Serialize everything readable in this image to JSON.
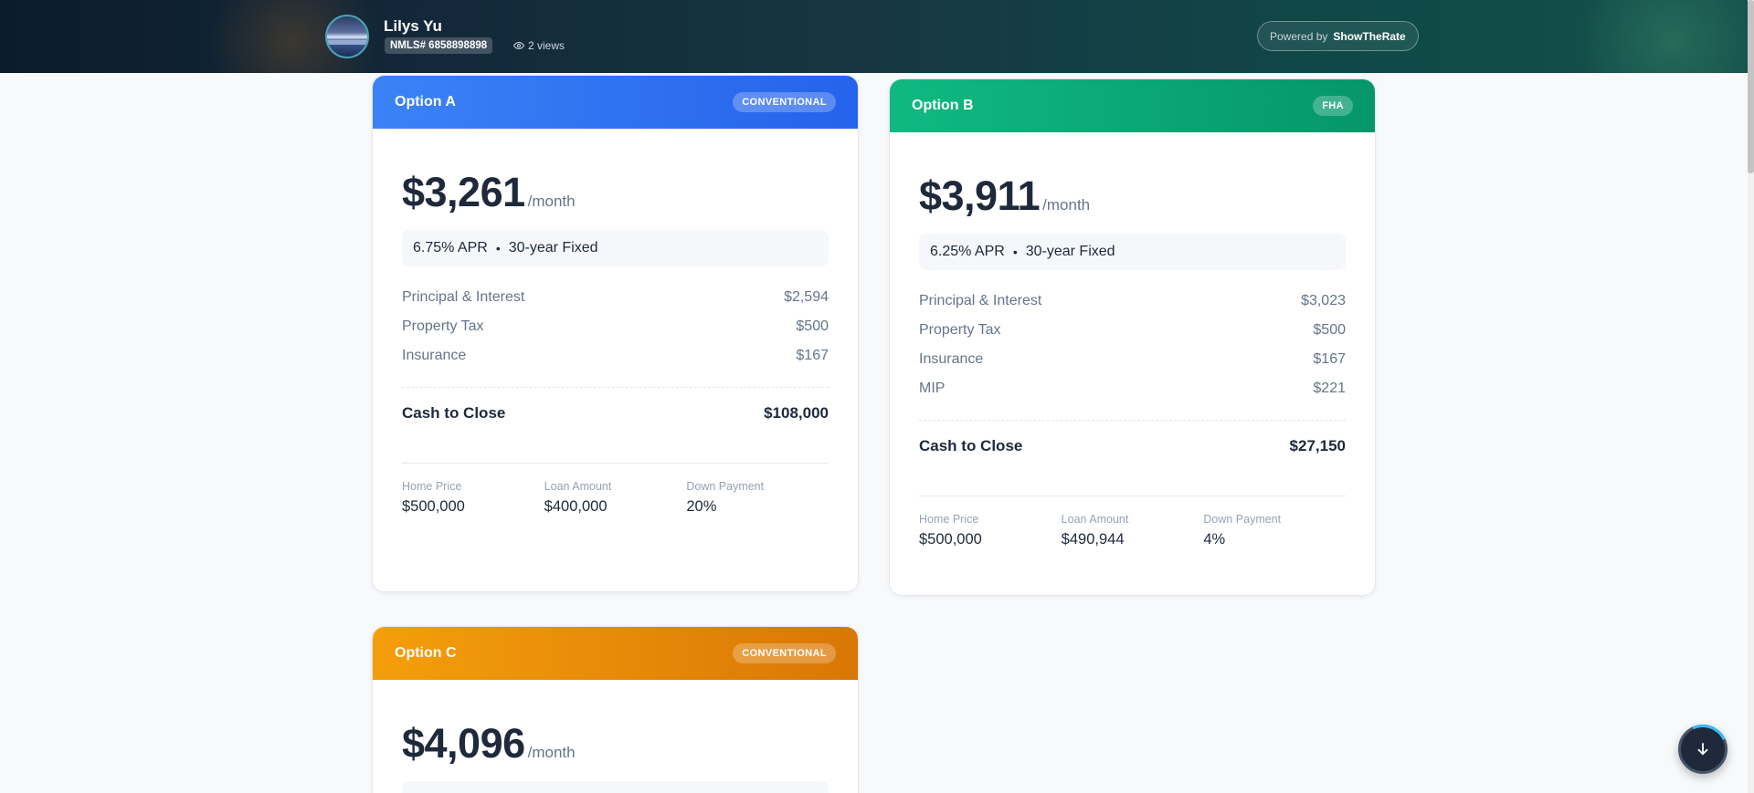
{
  "header": {
    "name": "Lilys Yu",
    "nmls": "NMLS# 6858898898",
    "views": "2 views",
    "powered_prefix": "Powered by",
    "powered_brand": "ShowTheRate"
  },
  "options": [
    {
      "title": "Option A",
      "badge": "CONVENTIONAL",
      "color": "#3b82f6",
      "payment": "$3,261",
      "per": "/month",
      "apr": "6.75% APR",
      "dot": "•",
      "term": "30-year Fixed",
      "items": [
        {
          "label": "Principal & Interest",
          "value": "$2,594"
        },
        {
          "label": "Property Tax",
          "value": "$500"
        },
        {
          "label": "Insurance",
          "value": "$167"
        }
      ],
      "cash_to_close_label": "Cash to Close",
      "cash_to_close": "$108,000",
      "stats": [
        {
          "label": "Home Price",
          "value": "$500,000"
        },
        {
          "label": "Loan Amount",
          "value": "$400,000"
        },
        {
          "label": "Down Payment",
          "value": "20%"
        }
      ]
    },
    {
      "title": "Option B",
      "badge": "FHA",
      "color": "#10b981",
      "payment": "$3,911",
      "per": "/month",
      "apr": "6.25% APR",
      "dot": "•",
      "term": "30-year Fixed",
      "items": [
        {
          "label": "Principal & Interest",
          "value": "$3,023"
        },
        {
          "label": "Property Tax",
          "value": "$500"
        },
        {
          "label": "Insurance",
          "value": "$167"
        },
        {
          "label": "MIP",
          "value": "$221"
        }
      ],
      "cash_to_close_label": "Cash to Close",
      "cash_to_close": "$27,150",
      "stats": [
        {
          "label": "Home Price",
          "value": "$500,000"
        },
        {
          "label": "Loan Amount",
          "value": "$490,944"
        },
        {
          "label": "Down Payment",
          "value": "4%"
        }
      ]
    },
    {
      "title": "Option C",
      "badge": "CONVENTIONAL",
      "color": "#f59e0b",
      "payment": "$4,096",
      "per": "/month"
    }
  ],
  "icons": {
    "views": "eye-icon",
    "scroll": "arrow-down-icon"
  }
}
